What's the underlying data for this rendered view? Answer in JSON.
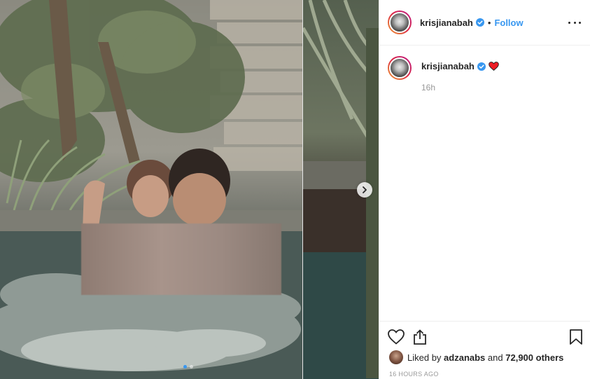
{
  "post": {
    "username": "krisjianabah",
    "separator": "•",
    "follow_label": "Follow",
    "more_icon": "more-options-icon"
  },
  "caption": {
    "username": "krisjianabah",
    "emoji_icon": "red-heart-icon",
    "relative_time": "16h"
  },
  "media": {
    "slide_count": 2,
    "active_slide": 1,
    "next_icon": "chevron-right-icon"
  },
  "actions": {
    "like_icon": "heart-icon",
    "share_icon": "share-icon",
    "save_icon": "bookmark-icon"
  },
  "likes": {
    "prefix": "Liked by",
    "first_user": "adzanabs",
    "middle": "and",
    "others": "72,900 others"
  },
  "timestamp": "16 HOURS AGO",
  "colors": {
    "accent": "#3897f0",
    "heart": "#ed4956",
    "text": "#262626",
    "muted": "#999999"
  }
}
